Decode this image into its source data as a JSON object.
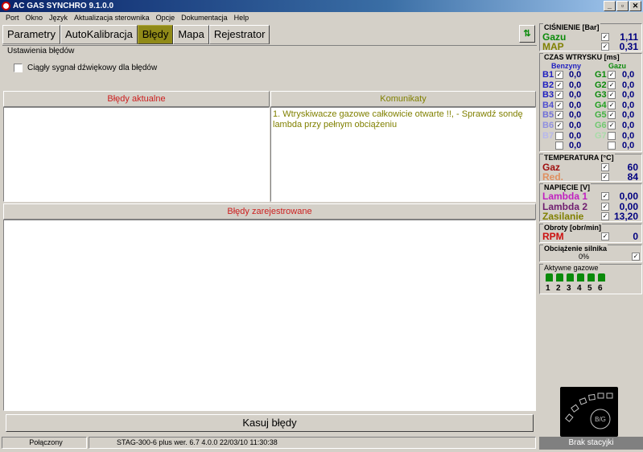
{
  "window": {
    "title": "AC GAS SYNCHRO  9.1.0.0",
    "min": "_",
    "restore": "▫",
    "close": "✕"
  },
  "menu": [
    "Port",
    "Okno",
    "Język",
    "Aktualizacja sterownika",
    "Opcje",
    "Dokumentacja",
    "Help"
  ],
  "tabs": [
    {
      "label": "Parametry",
      "active": false
    },
    {
      "label": "AutoKalibracja",
      "active": false
    },
    {
      "label": "Błędy",
      "active": true
    },
    {
      "label": "Mapa",
      "active": false
    },
    {
      "label": "Rejestrator",
      "active": false
    }
  ],
  "settings": {
    "legend": "Ustawienia błędów",
    "checkbox_label": "Ciągły sygnał dźwiękowy dla błędów",
    "checked": false
  },
  "current_errors": {
    "header": "Błędy aktualne",
    "color": "#cc2020"
  },
  "messages": {
    "header": "Komunikaty",
    "color": "#808000",
    "text": "1. Wtryskiwacze gazowe całkowicie otwarte !!, - Sprawdź sondę lambda przy pełnym obciążeniu"
  },
  "registered": {
    "header": "Błędy zarejestrowane",
    "color": "#cc2020"
  },
  "clear_button": "Kasuj błędy",
  "status": {
    "connection": "Połączony",
    "device": "STAG-300-6 plus   wer. 6.7  4.0.0    22/03/10 11:30:38"
  },
  "pressure": {
    "title": "CIŚNIENIE [Bar]",
    "gas_label": "Gazu",
    "gas_value": "1,11",
    "map_label": "MAP",
    "map_value": "0,31"
  },
  "injection": {
    "title": "CZAS WTRYSKU  [ms]",
    "petrol_header": "Benzyny",
    "gas_header": "Gazu",
    "rows": [
      {
        "b": "B1",
        "bv": "0,0",
        "g": "G1",
        "gv": "0,0",
        "bc": "#2020c0",
        "gc": "#0a8a0a"
      },
      {
        "b": "B2",
        "bv": "0,0",
        "g": "G2",
        "gv": "0,0",
        "bc": "#2020c0",
        "gc": "#0a8a0a"
      },
      {
        "b": "B3",
        "bv": "0,0",
        "g": "G3",
        "gv": "0,0",
        "bc": "#2020c0",
        "gc": "#0a8a0a"
      },
      {
        "b": "B4",
        "bv": "0,0",
        "g": "G4",
        "gv": "0,0",
        "bc": "#5050d0",
        "gc": "#20a020"
      },
      {
        "b": "B5",
        "bv": "0,0",
        "g": "G5",
        "gv": "0,0",
        "bc": "#7070d8",
        "gc": "#40b040"
      },
      {
        "b": "B6",
        "bv": "0,0",
        "g": "G6",
        "gv": "0,0",
        "bc": "#9090e0",
        "gc": "#70c870"
      },
      {
        "b": "B7",
        "bv": "0,0",
        "g": "G7",
        "gv": "0,0",
        "bc": "#b8b8ec",
        "gc": "#a8dca8"
      },
      {
        "b": "",
        "bv": "0,0",
        "g": "",
        "gv": "0,0",
        "bc": "#d0d0f0",
        "gc": "#c8e8c8"
      }
    ]
  },
  "temperature": {
    "title": "TEMPERATURA  [°C]",
    "gas_label": "Gaz",
    "gas_value": "60",
    "red_label": "Red.",
    "red_value": "84"
  },
  "voltage": {
    "title": "NAPIĘCIE [V]",
    "l1_label": "Lambda 1",
    "l1_value": "0,00",
    "l2_label": "Lambda 2",
    "l2_value": "0,00",
    "sup_label": "Zasilanie",
    "sup_value": "13,20"
  },
  "rpm": {
    "title": "Obroty [obr/min]",
    "label": "RPM",
    "value": "0"
  },
  "load": {
    "title": "Obciążenie silnika",
    "value": "0%"
  },
  "active_gas": {
    "title": "Aktywne gazowe",
    "numbers": [
      "1",
      "2",
      "3",
      "4",
      "5",
      "6"
    ]
  },
  "logo_text": "B/G",
  "brak": "Brak stacyjki"
}
